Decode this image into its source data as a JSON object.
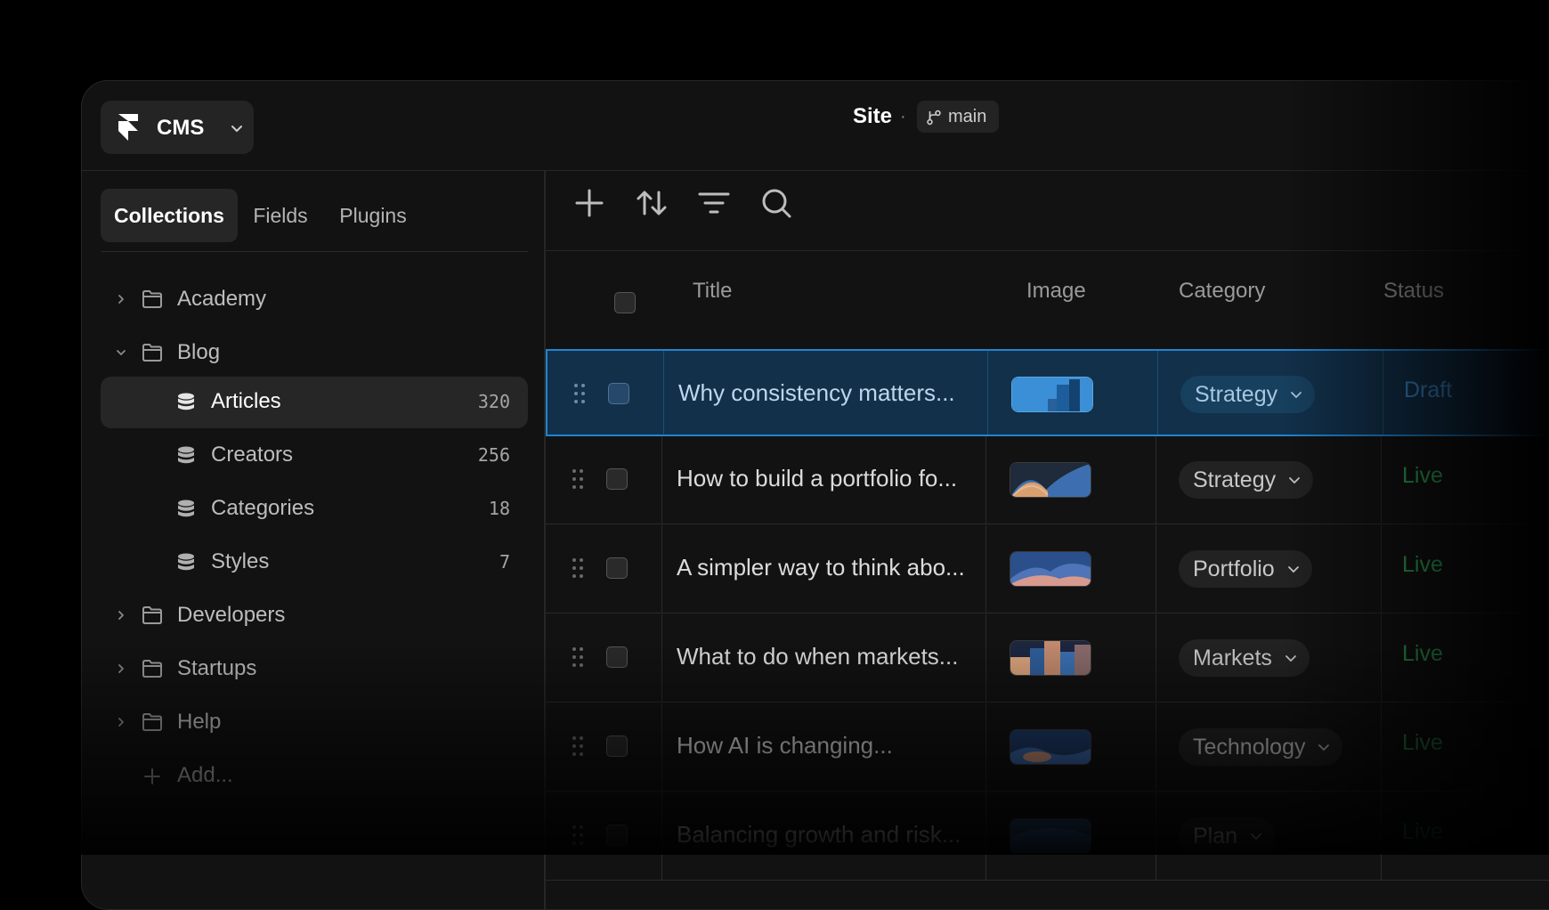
{
  "header": {
    "app_label": "CMS",
    "site_title": "Site",
    "separator": "·",
    "branch": "main"
  },
  "sidebar": {
    "tabs": [
      {
        "label": "Collections",
        "active": true
      },
      {
        "label": "Fields",
        "active": false
      },
      {
        "label": "Plugins",
        "active": false
      }
    ],
    "tree": [
      {
        "type": "folder",
        "label": "Academy",
        "expanded": false
      },
      {
        "type": "folder",
        "label": "Blog",
        "expanded": true
      },
      {
        "type": "collection",
        "label": "Articles",
        "count": "320",
        "selected": true
      },
      {
        "type": "collection",
        "label": "Creators",
        "count": "256"
      },
      {
        "type": "collection",
        "label": "Categories",
        "count": "18"
      },
      {
        "type": "collection",
        "label": "Styles",
        "count": "7"
      },
      {
        "type": "folder",
        "label": "Developers",
        "expanded": false
      },
      {
        "type": "folder",
        "label": "Startups",
        "expanded": false
      },
      {
        "type": "folder",
        "label": "Help",
        "expanded": false
      }
    ],
    "add_label": "Add..."
  },
  "toolbar": {
    "icons": [
      "plus-icon",
      "sort-icon",
      "filter-icon",
      "search-icon"
    ]
  },
  "table": {
    "columns": {
      "title": "Title",
      "image": "Image",
      "category": "Category",
      "status": "Status"
    },
    "rows": [
      {
        "title": "Why consistency matters...",
        "category": "Strategy",
        "status": "Draft",
        "selected": true
      },
      {
        "title": "How to build a portfolio fo...",
        "category": "Strategy",
        "status": "Live"
      },
      {
        "title": "A simpler way to think abo...",
        "category": "Portfolio",
        "status": "Live"
      },
      {
        "title": "What to do when markets...",
        "category": "Markets",
        "status": "Live"
      },
      {
        "title": "How AI is changing...",
        "category": "Technology",
        "status": "Live"
      },
      {
        "title": "Balancing growth and risk...",
        "category": "Plan",
        "status": "Live"
      }
    ]
  },
  "colors": {
    "selection_border": "#1f84d1",
    "selection_bg": "#12304a",
    "live_status": "#2fae5c",
    "draft_status": "#3b8bd0"
  }
}
